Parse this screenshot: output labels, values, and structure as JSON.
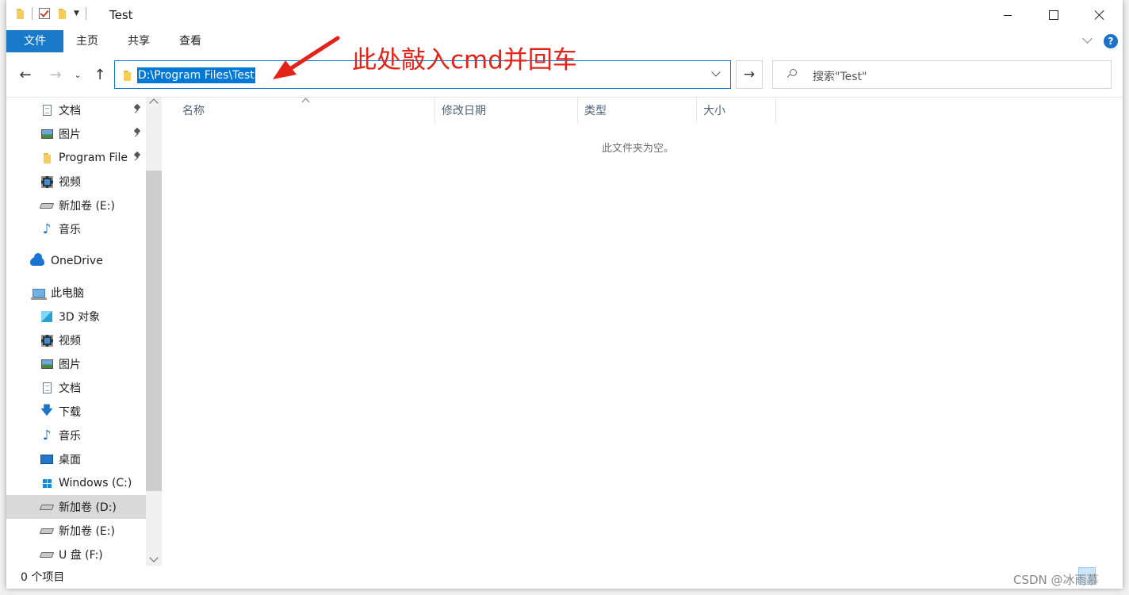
{
  "window": {
    "title": "Test",
    "minimize_label": "—",
    "maximize_label": "☐",
    "close_label": "✕"
  },
  "ribbon": {
    "tabs": [
      {
        "label": "文件"
      },
      {
        "label": "主页"
      },
      {
        "label": "共享"
      },
      {
        "label": "查看"
      }
    ],
    "help_label": "?"
  },
  "navigation": {
    "address_path": "D:\\Program Files\\Test",
    "search_placeholder": "搜索\"Test\""
  },
  "annotation": {
    "text": "此处敲入cmd并回车",
    "color": "#e42318"
  },
  "sidebar": {
    "items": [
      {
        "label": "文档",
        "icon": "document-icon",
        "pinned": true
      },
      {
        "label": "图片",
        "icon": "picture-icon",
        "pinned": true
      },
      {
        "label": "Program File",
        "icon": "folder-icon",
        "pinned": true
      },
      {
        "label": "视频",
        "icon": "video-icon",
        "pinned": false
      },
      {
        "label": "新加卷 (E:)",
        "icon": "drive-icon",
        "pinned": false
      },
      {
        "label": "音乐",
        "icon": "music-icon",
        "pinned": false
      },
      {
        "label": "OneDrive",
        "icon": "onedrive-icon",
        "pinned": false
      },
      {
        "label": "此电脑",
        "icon": "computer-icon",
        "pinned": false
      },
      {
        "label": "3D 对象",
        "icon": "3d-objects-icon",
        "pinned": false
      },
      {
        "label": "视频",
        "icon": "video-icon",
        "pinned": false
      },
      {
        "label": "图片",
        "icon": "picture-icon",
        "pinned": false
      },
      {
        "label": "文档",
        "icon": "document-icon",
        "pinned": false
      },
      {
        "label": "下载",
        "icon": "download-icon",
        "pinned": false
      },
      {
        "label": "音乐",
        "icon": "music-icon",
        "pinned": false
      },
      {
        "label": "桌面",
        "icon": "desktop-icon",
        "pinned": false
      },
      {
        "label": "Windows (C:)",
        "icon": "windows-drive-icon",
        "pinned": false
      },
      {
        "label": "新加卷 (D:)",
        "icon": "drive-icon",
        "pinned": false,
        "selected": true
      },
      {
        "label": "新加卷 (E:)",
        "icon": "drive-icon",
        "pinned": false
      },
      {
        "label": "U 盘 (F:)",
        "icon": "drive-icon",
        "pinned": false
      }
    ]
  },
  "content": {
    "columns": [
      {
        "label": "名称"
      },
      {
        "label": "修改日期"
      },
      {
        "label": "类型"
      },
      {
        "label": "大小"
      }
    ],
    "empty_message": "此文件夹为空。"
  },
  "statusbar": {
    "item_count": "0 个项目"
  },
  "watermark": {
    "text": "CSDN @冰雨慕"
  },
  "colors": {
    "accent": "#1979ca",
    "selection": "#0078d7"
  }
}
